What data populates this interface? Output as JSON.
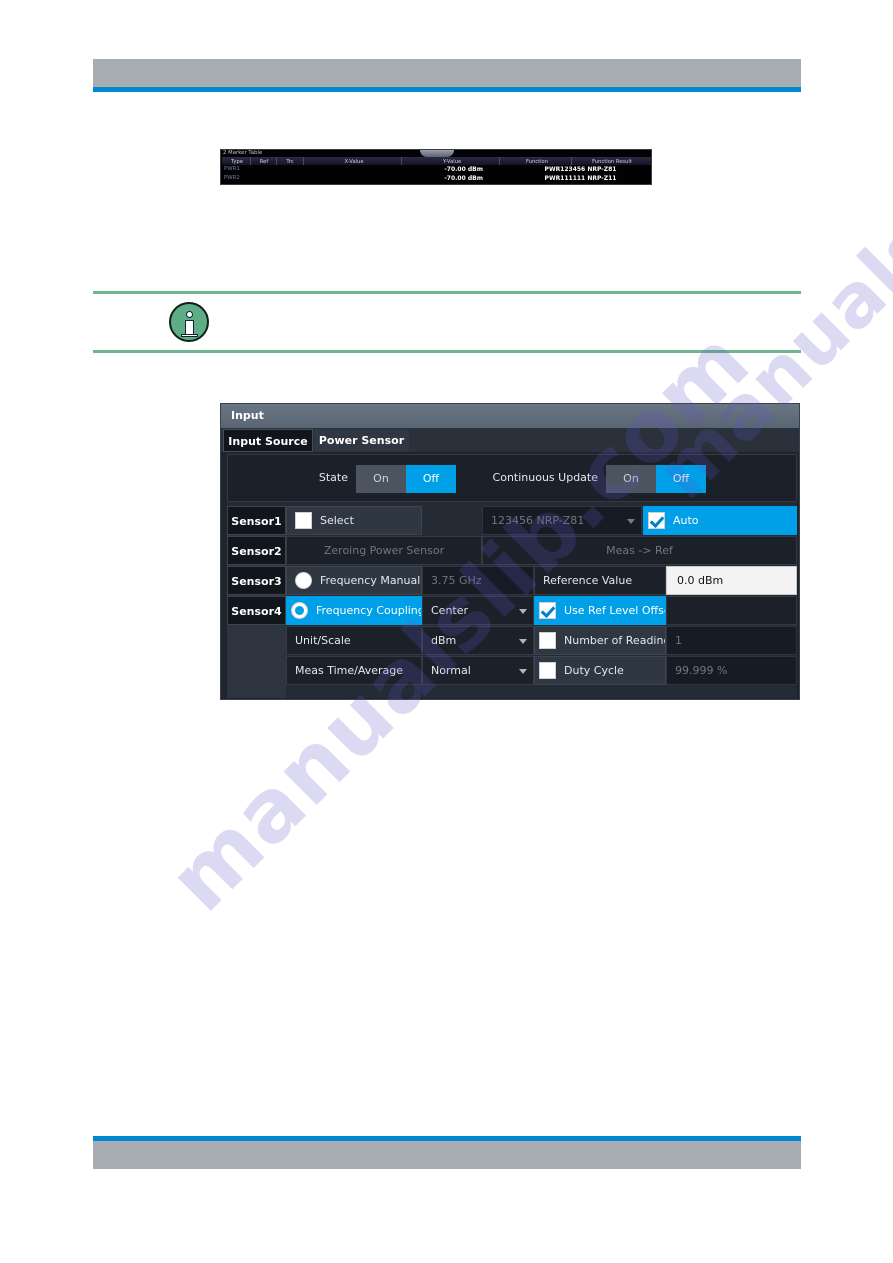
{
  "page": {
    "header_band_color": "#a8adb2",
    "accent_rule_color": "#0089cf",
    "watermark_primary": "manualslib.com",
    "watermark_secondary": "manualslib.com"
  },
  "note": {
    "icon": "info-icon",
    "rule_color": "#6eb68f"
  },
  "marker_table": {
    "title": "2 Marker Table",
    "columns": [
      "Type",
      "Ref",
      "Trc",
      "X-Value",
      "Y-Value",
      "Function",
      "Function Result"
    ],
    "rows": [
      {
        "type": "PWR1",
        "ref": "",
        "trc": "",
        "x_value": "",
        "y_value": "-70.00 dBm",
        "function": "",
        "function_result": "PWR123456 NRP-Z81"
      },
      {
        "type": "PWR2",
        "ref": "",
        "trc": "",
        "x_value": "",
        "y_value": "-70.00 dBm",
        "function": "",
        "function_result": "PWR111111 NRP-Z11"
      }
    ]
  },
  "dialog": {
    "title": "Input",
    "tabs": [
      {
        "label": "Input Source",
        "active": false
      },
      {
        "label": "Power Sensor",
        "active": true
      }
    ],
    "state": {
      "label": "State",
      "options": [
        "On",
        "Off"
      ],
      "selected": "Off"
    },
    "continuous_update": {
      "label": "Continuous Update",
      "options": [
        "On",
        "Off"
      ],
      "selected": "Off"
    },
    "sensor_tabs": [
      {
        "label": "Sensor1"
      },
      {
        "label": "Sensor2"
      },
      {
        "label": "Sensor3"
      },
      {
        "label": "Sensor4"
      }
    ],
    "controls": {
      "select": {
        "label": "Select",
        "checked": false
      },
      "sensor_device": {
        "value": "123456 NRP-Z81",
        "disabled": true
      },
      "auto": {
        "label": "Auto",
        "checked": true,
        "highlight": true
      },
      "zeroing": {
        "label": "Zeroing Power Sensor",
        "disabled": true
      },
      "meas_to_ref": {
        "label": "Meas -> Ref",
        "disabled": true
      },
      "frequency_manual": {
        "label": "Frequency Manual",
        "selected": false
      },
      "frequency_manual_value": {
        "value": "3.75 GHz",
        "disabled": true
      },
      "reference_value": {
        "label": "Reference Value",
        "value": "0.0 dBm"
      },
      "frequency_coupling": {
        "label": "Frequency Coupling",
        "selected": true
      },
      "frequency_coupling_value": {
        "value": "Center"
      },
      "use_ref_level_offset": {
        "label": "Use Ref Level Offset",
        "checked": true,
        "highlight": true
      },
      "unit_scale": {
        "label": "Unit/Scale",
        "value": "dBm"
      },
      "number_of_readings": {
        "label": "Number of Readings",
        "checked": false,
        "value": "1",
        "value_disabled": true
      },
      "meas_time_average": {
        "label": "Meas Time/Average",
        "value": "Normal"
      },
      "duty_cycle": {
        "label": "Duty Cycle",
        "checked": false,
        "value": "99.999 %",
        "value_disabled": true
      }
    },
    "colors": {
      "accent": "#00a0e9",
      "titlebar": "#6b7685",
      "panel": "#252b35"
    }
  }
}
